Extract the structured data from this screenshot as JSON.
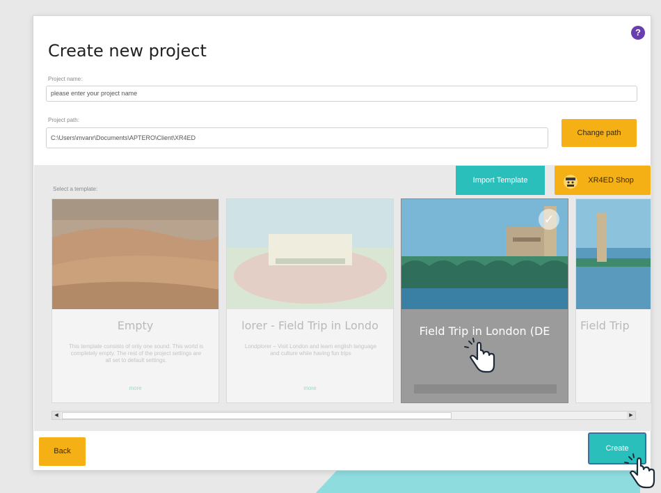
{
  "dialog": {
    "title": "Create new project",
    "help_icon": "?",
    "project_name_label": "Project name:",
    "project_name_placeholder": "please enter your project name",
    "project_path_label": "Project path:",
    "project_path_value": "C:\\Users\\mvanr\\Documents\\APTERO\\Client\\XR4ED",
    "change_path_label": "Change path"
  },
  "templates": {
    "select_label": "Select a template:",
    "import_label": "Import Template",
    "shop_label": "XR4ED Shop",
    "cards": [
      {
        "name": "Empty",
        "description": "This template consists of only one sound. This world is completely empty. The rest of the project settings are all set to default settings.",
        "more": "more"
      },
      {
        "name": "lorer - Field Trip in Londo",
        "description": "Londplorer – Visit London and learn english language and culture while having fun trips",
        "more": "more"
      },
      {
        "name": "Field Trip in London (DE",
        "selected": true
      },
      {
        "name": "Field Trip",
        "description": "",
        "more": ""
      }
    ]
  },
  "footer": {
    "back_label": "Back",
    "create_label": "Create"
  },
  "icons": {
    "check": "check-icon",
    "cursor": "hand-pointer-icon",
    "shop": "shop-avatar-icon"
  },
  "colors": {
    "accent_yellow": "#f4b014",
    "accent_teal": "#2bbfbb",
    "help_purple": "#6a3db0"
  }
}
